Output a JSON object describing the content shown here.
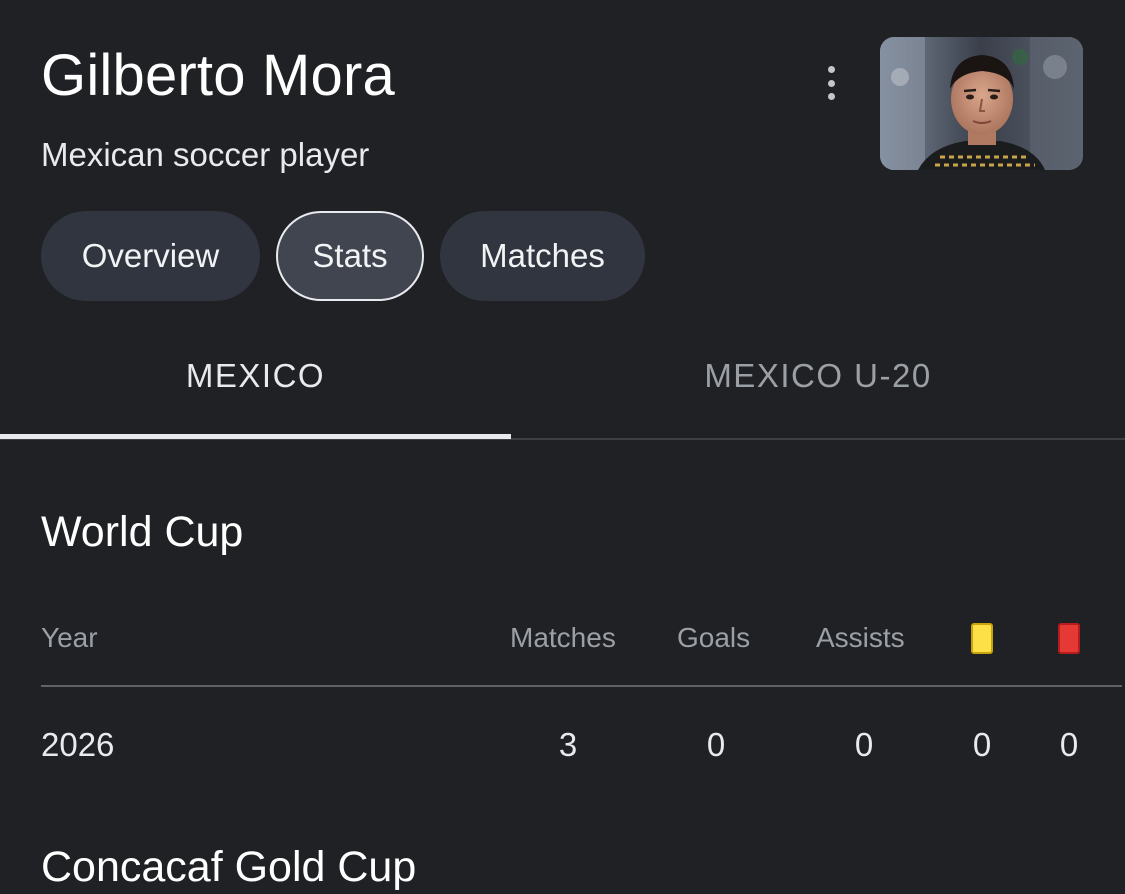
{
  "player": {
    "name": "Gilberto Mora",
    "description": "Mexican soccer player"
  },
  "header": {
    "more_icon": "more-vert-icon",
    "photo_alt": "Gilberto Mora"
  },
  "chips": [
    {
      "label": "Overview",
      "selected": false
    },
    {
      "label": "Stats",
      "selected": true
    },
    {
      "label": "Matches",
      "selected": false
    }
  ],
  "team_tabs": [
    {
      "label": "MEXICO",
      "active": true
    },
    {
      "label": "MEXICO U-20",
      "active": false
    }
  ],
  "competition": {
    "title": "World Cup",
    "columns": {
      "year": "Year",
      "matches": "Matches",
      "goals": "Goals",
      "assists": "Assists",
      "yellow_cards_icon": "yellow-card-icon",
      "red_cards_icon": "red-card-icon"
    },
    "rows": [
      {
        "year": "2026",
        "matches": "3",
        "goals": "0",
        "assists": "0",
        "yellow_cards": "0",
        "red_cards": "0"
      }
    ]
  },
  "next_section_title": "Concacaf Gold Cup",
  "colors": {
    "background": "#202124",
    "chip": "#303540",
    "chip_selected": "#414550",
    "yellow_card": "#fde047",
    "red_card": "#e53935"
  }
}
